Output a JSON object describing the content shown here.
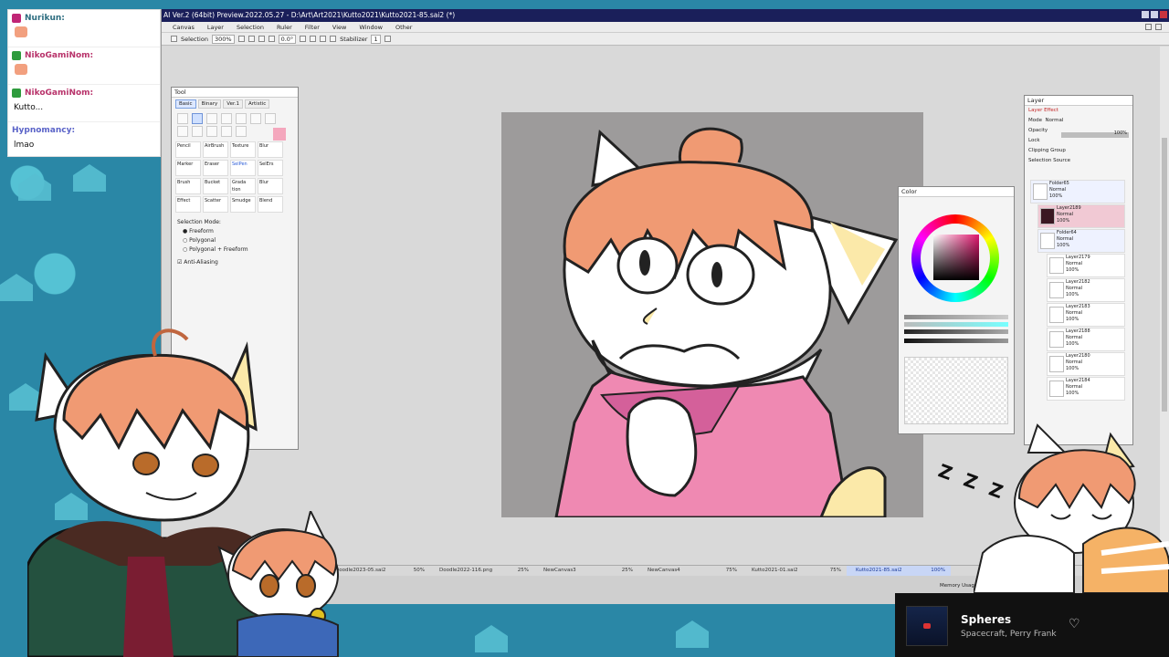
{
  "app": {
    "title": "AI Ver.2 (64bit) Preview.2022.05.27 - D:\\Art\\Art2021\\Kutto2021\\Kutto2021-85.sai2 (*)",
    "menu": [
      "Canvas",
      "Layer",
      "Selection",
      "Ruler",
      "Filter",
      "View",
      "Window",
      "Other"
    ],
    "toolbar": {
      "selection_label": "Selection",
      "zoom": "300%",
      "angle": "0.0°",
      "stabilizer_label": "Stabilizer",
      "stabilizer_value": "1"
    }
  },
  "tool_panel": {
    "title": "Tool",
    "tabs": [
      "Basic",
      "Binary",
      "Ver.1",
      "Artistic"
    ],
    "brushes": [
      "Pencil",
      "AirBrush",
      "Texture",
      "Blur",
      "Marker",
      "Eraser",
      "SelPen",
      "SelErs",
      "Brush",
      "Bucket",
      "Grada tion",
      "Blur",
      "Effect",
      "Scatter",
      "Smudge",
      "Blend"
    ],
    "selection_mode_label": "Selection Mode:",
    "modes": [
      "Freeform",
      "Polygonal",
      "Polygonal + Freeform"
    ],
    "anti_aliasing": "Anti-Aliasing"
  },
  "color_panel": {
    "title": "Color"
  },
  "layer_panel": {
    "title": "Layer",
    "effect": "Layer Effect",
    "mode_label": "Mode",
    "mode_value": "Normal",
    "opacity_label": "Opacity",
    "opacity_value": "100%",
    "lock_label": "Lock",
    "clipping_group": "Clipping Group",
    "selection_source": "Selection Source",
    "layers": [
      {
        "name": "Folder65",
        "mode": "Normal",
        "opacity": "100%"
      },
      {
        "name": "Layer2189",
        "mode": "Normal",
        "opacity": "100%"
      },
      {
        "name": "Folder64",
        "mode": "Normal",
        "opacity": "100%"
      },
      {
        "name": "Layer2179",
        "mode": "Normal",
        "opacity": "100%"
      },
      {
        "name": "Layer2182",
        "mode": "Normal",
        "opacity": "100%"
      },
      {
        "name": "Layer2183",
        "mode": "Normal",
        "opacity": "100%"
      },
      {
        "name": "Layer2188",
        "mode": "Normal",
        "opacity": "100%"
      },
      {
        "name": "Layer2180",
        "mode": "Normal",
        "opacity": "100%"
      },
      {
        "name": "Layer2184",
        "mode": "Normal",
        "opacity": "100%"
      }
    ]
  },
  "doc_tabs": [
    {
      "name": "Doodle2023-05.sai2",
      "zoom": "50%"
    },
    {
      "name": "Doodle2022-116.png",
      "zoom": "25%"
    },
    {
      "name": "NewCanvas3",
      "zoom": "25%"
    },
    {
      "name": "NewCanvas4",
      "zoom": "75%"
    },
    {
      "name": "Kutto2021-01.sai2",
      "zoom": "75%"
    },
    {
      "name": "Kutto2021-85.sai2",
      "zoom": "100%"
    }
  ],
  "status": {
    "memory": "Memory Usage"
  },
  "chat": [
    {
      "user": "Nurikun:",
      "text": "",
      "color": "#2b6c7f",
      "badge": "pink"
    },
    {
      "user": "NikoGamiNom:",
      "text": "",
      "color": "#b8326a",
      "badge": "green"
    },
    {
      "user": "NikoGamiNom:",
      "text": "Kutto...",
      "color": "#b8326a",
      "badge": "green"
    },
    {
      "user": "Hypnomancy:",
      "text": "lmao",
      "color": "#5a63c8",
      "badge": ""
    }
  ],
  "music": {
    "track": "Spheres",
    "artist": "Spacecraft, Perry Frank"
  },
  "overlay": {
    "zzz": "Z Z Z"
  },
  "colors": {
    "hair": "#f09a73",
    "fur_yellow": "#fbe9a9",
    "shirt_pink": "#ef89b2",
    "canvas_gray": "#9d9b9b",
    "bg_teal": "#2a87a6"
  }
}
